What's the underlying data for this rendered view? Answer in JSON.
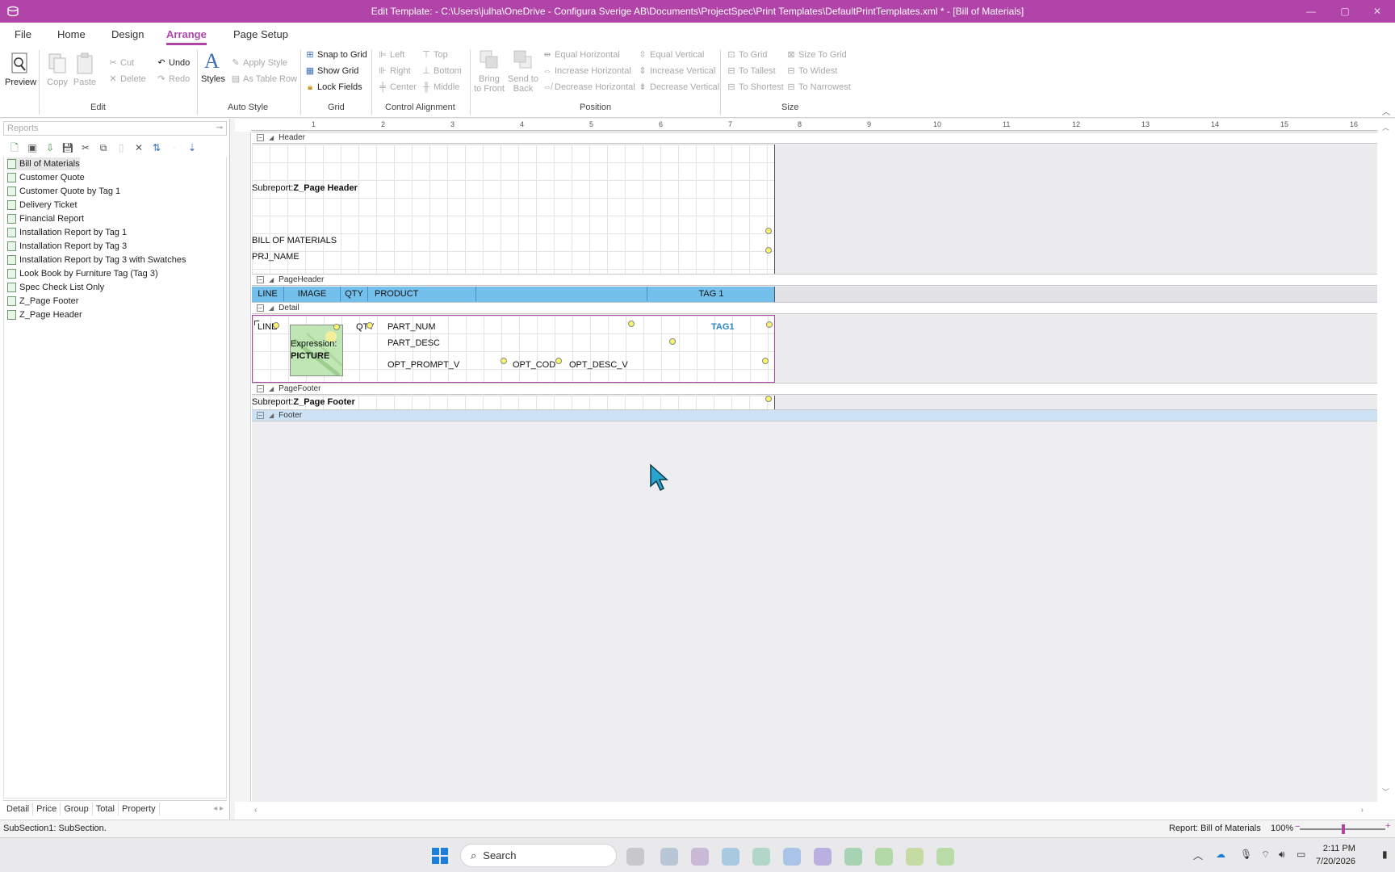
{
  "window": {
    "title": "Edit Template: - C:\\Users\\julha\\OneDrive - Configura Sverige AB\\Documents\\ProjectSpec\\Print Templates\\DefaultPrintTemplates.xml * - [Bill of Materials]"
  },
  "ribbon_tabs": [
    "File",
    "Home",
    "Design",
    "Arrange",
    "Page Setup"
  ],
  "active_tab": "Arrange",
  "ribbon": {
    "preview": "Preview",
    "edit": {
      "copy": "Copy",
      "paste": "Paste",
      "cut": "Cut",
      "delete": "Delete",
      "undo": "Undo",
      "redo": "Redo",
      "label": "Edit"
    },
    "auto_style": {
      "styles": "Styles",
      "apply_style": "Apply Style",
      "as_table_row": "As Table Row",
      "label": "Auto Style"
    },
    "grid": {
      "snap": "Snap to Grid",
      "show": "Show Grid",
      "lock": "Lock Fields",
      "label": "Grid"
    },
    "control_alignment": {
      "left": "Left",
      "right": "Right",
      "center": "Center",
      "top": "Top",
      "bottom": "Bottom",
      "middle": "Middle",
      "label": "Control Alignment"
    },
    "position": {
      "bring_front_1": "Bring",
      "bring_front_2": "to Front",
      "send_back_1": "Send to",
      "send_back_2": "Back",
      "eq_h": "Equal Horizontal",
      "inc_h": "Increase Horizontal",
      "dec_h": "Decrease Horizontal",
      "eq_v": "Equal Vertical",
      "inc_v": "Increase Vertical",
      "dec_v": "Decrease Vertical",
      "label": "Position"
    },
    "size": {
      "to_grid": "To Grid",
      "to_tallest": "To Tallest",
      "to_shortest": "To Shortest",
      "size_to_grid": "Size To Grid",
      "to_widest": "To Widest",
      "to_narrowest": "To Narrowest",
      "label": "Size"
    }
  },
  "left_panel": {
    "search_placeholder": "Reports",
    "reports": [
      "Bill of Materials",
      "Customer Quote",
      "Customer Quote by Tag 1",
      "Delivery Ticket",
      "Financial Report",
      "Installation Report by Tag 1",
      "Installation Report by Tag 3",
      "Installation Report by Tag 3 with Swatches",
      "Look Book by Furniture Tag (Tag 3)",
      "Spec Check List Only",
      "Z_Page Footer",
      "Z_Page Header"
    ],
    "selected": "Bill of Materials",
    "bottom_tabs": [
      "Detail",
      "Price",
      "Group",
      "Total",
      "Property"
    ]
  },
  "ruler": {
    "ticks": [
      "1",
      "2",
      "3",
      "4",
      "5",
      "6",
      "7",
      "8",
      "9",
      "10",
      "11",
      "12",
      "13",
      "14",
      "15",
      "16"
    ]
  },
  "bands": {
    "header": {
      "label": "Header",
      "subreport_prefix": "Subreport:",
      "subreport_name": "Z_Page Header",
      "title": "BILL OF MATERIALS",
      "prj": "PRJ_NAME"
    },
    "page_header": {
      "label": "PageHeader",
      "columns": [
        "LINE",
        "IMAGE",
        "QTY",
        "PRODUCT",
        "TAG 1"
      ]
    },
    "detail": {
      "label": "Detail",
      "line": "LINE",
      "expr_label": "Expression:",
      "expr_value": "PICTURE",
      "qty": "QTY",
      "part_num": "PART_NUM",
      "part_desc": "PART_DESC",
      "opt_prompt": "OPT_PROMPT_V",
      "opt_code": "OPT_COD",
      "opt_desc": "OPT_DESC_V",
      "tag1": "TAG1"
    },
    "page_footer": {
      "label": "PageFooter",
      "subreport_prefix": "Subreport:",
      "subreport_name": "Z_Page Footer"
    },
    "footer": {
      "label": "Footer"
    }
  },
  "status": {
    "left": "SubSection1: SubSection.",
    "report": "Report: Bill of Materials",
    "zoom": "100%"
  },
  "taskbar": {
    "search": "Search",
    "time": "2:11 PM",
    "date": "7/20/2026"
  },
  "colors": {
    "accent": "#b044a8",
    "page_header_band": "#74c0ec"
  }
}
